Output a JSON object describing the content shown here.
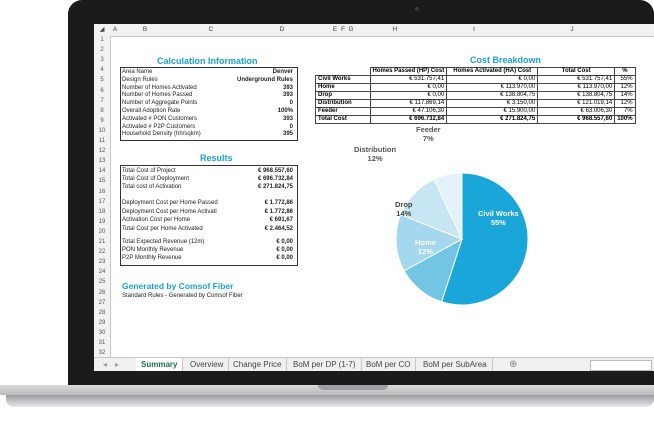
{
  "sheet": {
    "columns": [
      "A",
      "B",
      "C",
      "D",
      "E",
      "F",
      "G",
      "H",
      "I",
      "J"
    ],
    "rows": [
      "1",
      "2",
      "3",
      "4",
      "5",
      "6",
      "7",
      "8",
      "9",
      "10",
      "11",
      "12",
      "13",
      "14",
      "15",
      "16",
      "17",
      "18",
      "19",
      "20",
      "21",
      "22",
      "23",
      "24",
      "25",
      "26",
      "27",
      "28",
      "29",
      "30",
      "31",
      "32"
    ]
  },
  "calc": {
    "title": "Calculation Information",
    "rows": [
      {
        "label": "Area Name",
        "value": "Denver"
      },
      {
        "label": "Design Rules",
        "value": "Underground Rules"
      },
      {
        "label": "Number of Homes Activated",
        "value": "393"
      },
      {
        "label": "Number of Homes Passed",
        "value": "393"
      },
      {
        "label": "Number of Aggregate Points",
        "value": "0"
      },
      {
        "label": "Overall Adoption Rate",
        "value": "100%"
      },
      {
        "label": "Activated # PON Customers",
        "value": "393"
      },
      {
        "label": "Activated # P2P Customers",
        "value": "0"
      },
      {
        "label": "Household Density (hh/sqkm)",
        "value": "395"
      }
    ]
  },
  "results": {
    "title": "Results",
    "group1": [
      {
        "label": "Total Cost of Project",
        "value": "€ 968.557,60"
      },
      {
        "label": "Total Cost of Deployment",
        "value": "€ 696.732,84"
      },
      {
        "label": "Total cost of Activation",
        "value": "€ 271.824,75"
      }
    ],
    "group2": [
      {
        "label": "Deployment Cost per Home Passed",
        "value": "€ 1.772,86"
      },
      {
        "label": "Deployment Cost per Home Activati",
        "value": "€ 1.772,86"
      },
      {
        "label": "Activation Cost per Home",
        "value": "€ 691,67"
      },
      {
        "label": "Total Cost per Home Activated",
        "value": "€ 2.464,52"
      }
    ],
    "group3": [
      {
        "label": "Total Expected Revenue (12m)",
        "value": "€ 0,00"
      },
      {
        "label": "PON Monthly Revenue",
        "value": "€ 0,00"
      },
      {
        "label": "P2P Monthly Revenue",
        "value": "€ 0,00"
      }
    ]
  },
  "generated": {
    "title": "Generated by Comsof Fiber",
    "subtitle": "Standard Rules - Generated by Comsof Fiber"
  },
  "cost": {
    "title": "Cost Breakdown",
    "headers": [
      "",
      "Homes Passed (HP) Cost",
      "Homes Activated (HA) Cost",
      "Total Cost",
      "%"
    ],
    "rows": [
      [
        "Civil Works",
        "€ 531.757,41",
        "€ 0,00",
        "€ 531.757,41",
        "55%"
      ],
      [
        "Home",
        "€ 0,00",
        "€ 113.970,00",
        "€ 113.970,00",
        "12%"
      ],
      [
        "Drop",
        "€ 0,00",
        "€ 138.804,75",
        "€ 138.804,75",
        "14%"
      ],
      [
        "Distribution",
        "€ 117.869,14",
        "€ 3.150,00",
        "€ 121.019,14",
        "12%"
      ],
      [
        "Feeder",
        "€ 47.106,30",
        "€ 15.900,00",
        "€ 63.006,30",
        "7%"
      ],
      [
        "Total Cost",
        "€ 696.732,84",
        "€ 271.824,75",
        "€ 968.557,60",
        "100%"
      ]
    ]
  },
  "chart_data": {
    "type": "pie",
    "categories": [
      "Civil Works",
      "Home",
      "Drop",
      "Distribution",
      "Feeder"
    ],
    "values": [
      55,
      12,
      14,
      12,
      7
    ],
    "colors": [
      "#1aa6d9",
      "#73c5e6",
      "#a3d8ee",
      "#c6e6f4",
      "#e3f2f9"
    ]
  },
  "tabs": [
    "Summary",
    "Overview",
    "Change Price",
    "BoM per DP (1-7)",
    "BoM per CO",
    "BoM per SubArea"
  ],
  "add_tab_icon": "⊕"
}
